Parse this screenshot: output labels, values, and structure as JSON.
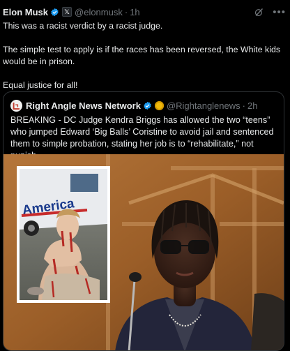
{
  "post": {
    "author_name": "Elon Musk",
    "author_handle": "@elonmusk",
    "separator": "·",
    "time": "1h",
    "paragraphs": [
      "This was a racist verdict by a racist judge.",
      "The simple test to apply is if the races has been reversed, the White kids would be in prison.",
      "Equal justice for all!"
    ],
    "icons": [
      "verified-badge-icon",
      "x-affiliate-badge-icon",
      "grok-icon",
      "more-icon"
    ]
  },
  "quote": {
    "author_name": "Right Angle News Network",
    "author_handle": "@Rightanglenews",
    "separator": "·",
    "time": "2h",
    "text": "BREAKING - DC Judge Kendra Briggs has allowed the two “teens” who jumped Edward ‘Big Balls’ Coristine to avoid jail and sentenced them to simple probation, stating her job is to “rehabilitate,” not punish.",
    "media": {
      "inset_van_lettering": "America",
      "description_icons": [
        "quoted-photo"
      ]
    }
  },
  "colors": {
    "background": "#000000",
    "text_primary": "#e7e9ea",
    "text_muted": "#71767b",
    "verified_blue": "#1d9bf0",
    "border": "#2f3336"
  }
}
